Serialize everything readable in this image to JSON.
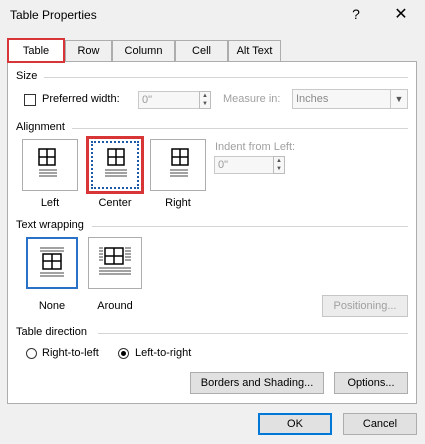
{
  "window": {
    "title": "Table Properties",
    "help_label": "?",
    "close_label": "✕"
  },
  "tabs": [
    {
      "label": "Table",
      "active": true
    },
    {
      "label": "Row"
    },
    {
      "label": "Column"
    },
    {
      "label": "Cell"
    },
    {
      "label": "Alt Text"
    }
  ],
  "size": {
    "section_label": "Size",
    "preferred_width_label": "Preferred width:",
    "preferred_width_value": "0\"",
    "measure_in_label": "Measure in:",
    "measure_in_value": "Inches"
  },
  "alignment": {
    "section_label": "Alignment",
    "options": [
      {
        "label": "Left"
      },
      {
        "label": "Center",
        "selected": true
      },
      {
        "label": "Right"
      }
    ],
    "indent_label": "Indent from Left:",
    "indent_value": "0\""
  },
  "text_wrapping": {
    "section_label": "Text wrapping",
    "options": [
      {
        "label": "None",
        "selected": true
      },
      {
        "label": "Around"
      }
    ],
    "positioning_label": "Positioning..."
  },
  "table_direction": {
    "section_label": "Table direction",
    "options": [
      {
        "label": "Right-to-left"
      },
      {
        "label": "Left-to-right",
        "selected": true
      }
    ]
  },
  "buttons": {
    "borders_label": "Borders and Shading...",
    "options_label": "Options...",
    "ok_label": "OK",
    "cancel_label": "Cancel"
  },
  "colors": {
    "highlight": "#d83636",
    "accent": "#0078d7",
    "selected_wrap": "#2a72c8"
  }
}
